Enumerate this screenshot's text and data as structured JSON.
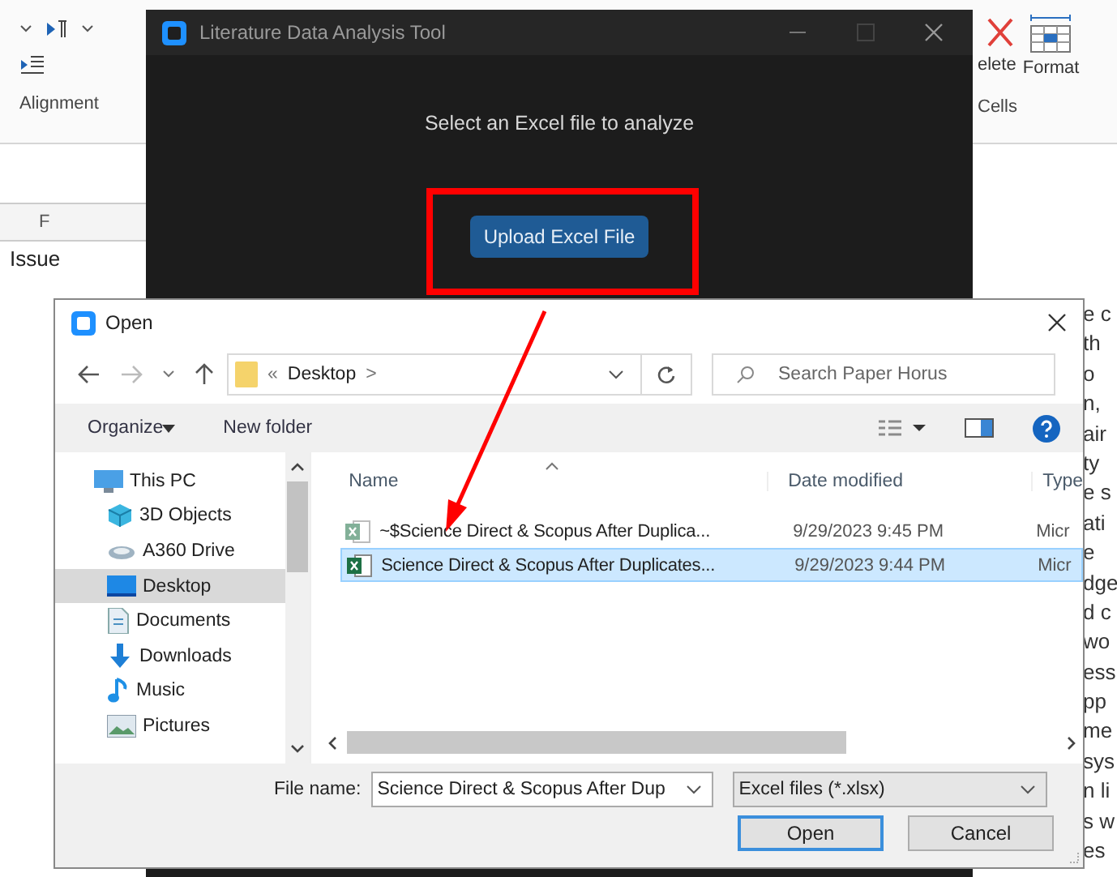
{
  "spreadsheet": {
    "ribbon_buttons": [
      {
        "label": "elete",
        "kind": "delete"
      },
      {
        "label": "Format",
        "kind": "format"
      }
    ],
    "ribbon_groups": [
      "Alignment",
      "Cells"
    ],
    "column_header": "F",
    "cell": "Issue",
    "side_text": [
      "e c",
      "th",
      "o",
      "n,",
      "air",
      "ty",
      "e s",
      "ati",
      "e",
      "dge",
      "d c",
      "wo",
      "ess",
      "pp",
      "me",
      "sys",
      "n li",
      "s w",
      "es"
    ]
  },
  "app_window": {
    "title": "Literature Data Analysis Tool",
    "prompt": "Select an Excel file to analyze",
    "upload_button": "Upload Excel File"
  },
  "dialog": {
    "title": "Open",
    "address": {
      "prefix": "«",
      "location": "Desktop",
      "separator": ">"
    },
    "search": {
      "placeholder": "Search Paper Horus"
    },
    "toolbar": [
      "Organize",
      "New folder"
    ],
    "nav_items": [
      {
        "label": "This PC",
        "kind": "pc",
        "selected": false,
        "children": [
          {
            "label": "3D Objects",
            "kind": "cube",
            "selected": false
          },
          {
            "label": "A360 Drive",
            "kind": "drive",
            "selected": false
          },
          {
            "label": "Desktop",
            "kind": "desktop",
            "selected": true
          },
          {
            "label": "Documents",
            "kind": "documents",
            "selected": false
          },
          {
            "label": "Downloads",
            "kind": "downloads",
            "selected": false
          },
          {
            "label": "Music",
            "kind": "music",
            "selected": false
          },
          {
            "label": "Pictures",
            "kind": "pictures",
            "selected": false
          }
        ]
      }
    ],
    "columns": [
      "Name",
      "Date modified",
      "Type"
    ],
    "files": [
      {
        "name": "~$Science Direct & Scopus After Duplica...",
        "date": "9/29/2023 9:45 PM",
        "type": "Micr",
        "hidden": true,
        "selected": false
      },
      {
        "name": "Science Direct & Scopus After Duplicates...",
        "date": "9/29/2023 9:44 PM",
        "type": "Micr",
        "hidden": false,
        "selected": true
      }
    ],
    "file_name_label": "File name:",
    "file_name": "Science Direct & Scopus After Dup",
    "file_type": "Excel files (*.xlsx)",
    "buttons": [
      {
        "label": "Open",
        "default": true
      },
      {
        "label": "Cancel",
        "default": false
      }
    ]
  }
}
